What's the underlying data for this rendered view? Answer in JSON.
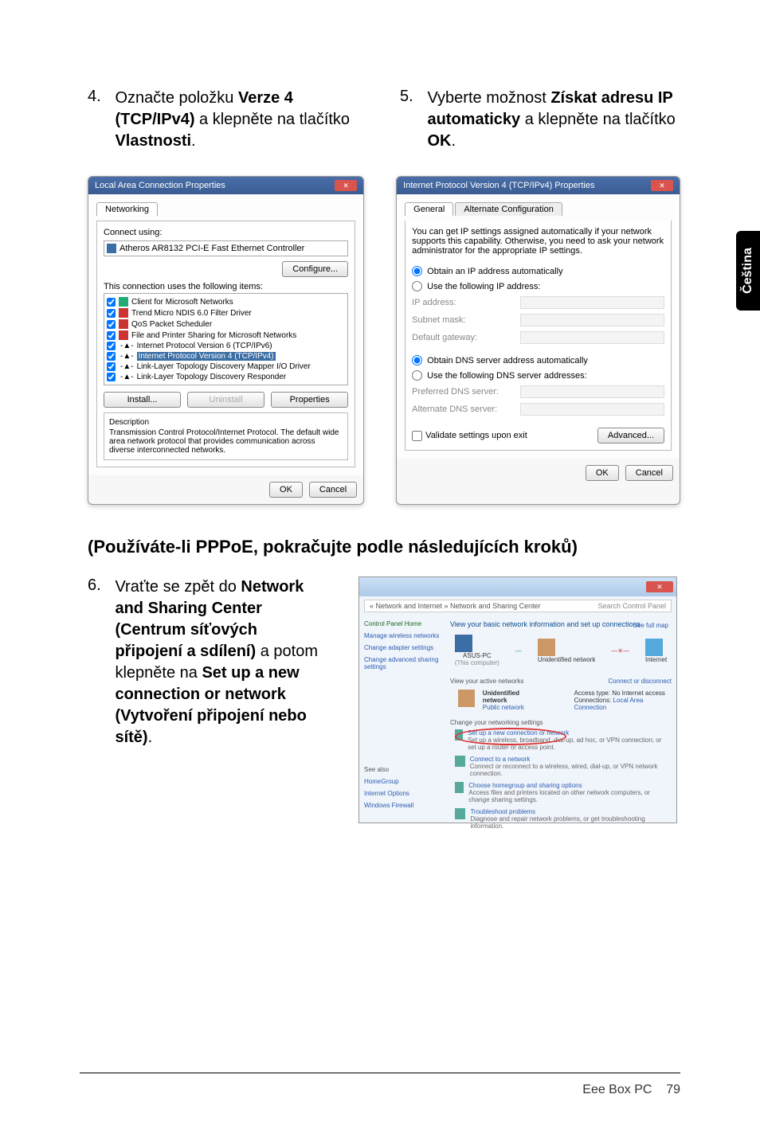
{
  "step4": {
    "num": "4.",
    "text_a": "Označte položku ",
    "bold_a": "Verze 4 (TCP/IPv4)",
    "text_b": " a klepněte na tlačítko ",
    "bold_b": "Vlastnosti",
    "text_c": "."
  },
  "step5": {
    "num": "5.",
    "text_a": "Vyberte možnost ",
    "bold_a": "Získat adresu IP automaticky",
    "text_b": " a klepněte na tlačítko ",
    "bold_b": "OK",
    "text_c": "."
  },
  "side_tab": "Čeština",
  "dialog1": {
    "title": "Local Area Connection Properties",
    "tab": "Networking",
    "connect_using_label": "Connect using:",
    "adapter": "Atheros AR8132 PCI-E Fast Ethernet Controller",
    "configure_btn": "Configure...",
    "uses_label": "This connection uses the following items:",
    "items": [
      "Client for Microsoft Networks",
      "Trend Micro NDIS 6.0 Filter Driver",
      "QoS Packet Scheduler",
      "File and Printer Sharing for Microsoft Networks",
      "Internet Protocol Version 6 (TCP/IPv6)",
      "Internet Protocol Version 4 (TCP/IPv4)",
      "Link-Layer Topology Discovery Mapper I/O Driver",
      "Link-Layer Topology Discovery Responder"
    ],
    "install_btn": "Install...",
    "uninstall_btn": "Uninstall",
    "properties_btn": "Properties",
    "desc_label": "Description",
    "desc_text": "Transmission Control Protocol/Internet Protocol. The default wide area network protocol that provides communication across diverse interconnected networks.",
    "ok": "OK",
    "cancel": "Cancel"
  },
  "dialog2": {
    "title": "Internet Protocol Version 4 (TCP/IPv4) Properties",
    "tab_general": "General",
    "tab_alt": "Alternate Configuration",
    "intro": "You can get IP settings assigned automatically if your network supports this capability. Otherwise, you need to ask your network administrator for the appropriate IP settings.",
    "radio_auto_ip": "Obtain an IP address automatically",
    "radio_use_ip": "Use the following IP address:",
    "ip_label": "IP address:",
    "subnet_label": "Subnet mask:",
    "gateway_label": "Default gateway:",
    "radio_auto_dns": "Obtain DNS server address automatically",
    "radio_use_dns": "Use the following DNS server addresses:",
    "pref_dns": "Preferred DNS server:",
    "alt_dns": "Alternate DNS server:",
    "validate": "Validate settings upon exit",
    "advanced": "Advanced...",
    "ok": "OK",
    "cancel": "Cancel"
  },
  "pppoe_heading": "(Používáte-li PPPoE, pokračujte podle následujících kroků)",
  "step6": {
    "num": "6.",
    "text_a": "Vraťte se zpět do ",
    "bold_a": "Network and Sharing Center (Centrum síťových připojení a sdílení)",
    "text_b": " a potom klepněte na ",
    "bold_b": "Set up a new connection or network (Vytvoření připojení nebo sítě)",
    "text_c": "."
  },
  "nsc": {
    "crumb": "  «  Network and Internet  »  Network and Sharing Center",
    "search": "Search Control Panel",
    "left": {
      "home": "Control Panel Home",
      "manage": "Manage wireless networks",
      "adapter": "Change adapter settings",
      "sharing": "Change advanced sharing settings"
    },
    "heading": "View your basic network information and set up connections",
    "full_map": "See full map",
    "node_pc": "ASUS-PC",
    "node_pc_sub": "(This computer)",
    "node_net": "Unidentified network",
    "node_internet": "Internet",
    "view_active": "View your active networks",
    "connect_disconnect": "Connect or disconnect",
    "unid_net": "Unidentified network",
    "public_net": "Public network",
    "access": "Access type:",
    "no_internet": "No Internet access",
    "connections": "Connections:",
    "lac": "Local Area Connection",
    "change_settings": "Change your networking settings",
    "setup_title": "Set up a new connection or network",
    "setup_desc": "Set up a wireless, broadband, dial-up, ad hoc, or VPN connection; or set up a router or access point.",
    "connect_title": "Connect to a network",
    "connect_desc": "Connect or reconnect to a wireless, wired, dial-up, or VPN network connection.",
    "homegroup_title": "Choose homegroup and sharing options",
    "homegroup_desc": "Access files and printers located on other network computers, or change sharing settings.",
    "troubleshoot_title": "Troubleshoot problems",
    "troubleshoot_desc": "Diagnose and repair network problems, or get troubleshooting information.",
    "see_also": "See also",
    "homegroup": "HomeGroup",
    "inet_options": "Internet Options",
    "firewall": "Windows Firewall"
  },
  "footer": {
    "product": "Eee Box PC",
    "page": "79"
  }
}
